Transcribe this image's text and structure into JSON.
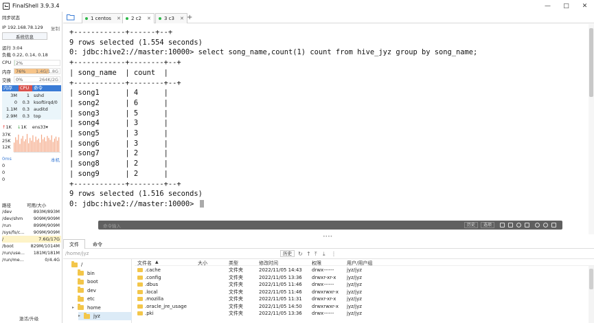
{
  "window": {
    "title": "FinalShell 3.9.3.4",
    "controls": [
      "minimize-icon",
      "maximize-icon",
      "close-icon"
    ]
  },
  "sidebar": {
    "sync_status": "同步状态",
    "ip_label": "IP 192.168.78.129",
    "copy_label": "复制",
    "sysinfo_button": "系统信息",
    "uptime": "运行 3:04",
    "load": "负载 0.22, 0.14, 0.18",
    "cpu": {
      "label": "CPU",
      "value": "2%",
      "percent": 2
    },
    "mem": {
      "label": "内存",
      "value": "76%",
      "detail": "1.4G/1.8G",
      "percent": 76
    },
    "swap": {
      "label": "交换",
      "value": "0%",
      "detail": "264K/2G",
      "percent": 0
    },
    "proc_headers": [
      "内存",
      "CPU",
      "命令"
    ],
    "processes": [
      {
        "mem": "3M",
        "cpu": "1",
        "cmd": "sshd"
      },
      {
        "mem": "0",
        "cpu": "0.3",
        "cmd": "ksoftirqd/0"
      },
      {
        "mem": "1.1M",
        "cpu": "0.3",
        "cmd": "auditd"
      },
      {
        "mem": "2.9M",
        "cpu": "0.3",
        "cmd": "top"
      }
    ],
    "net": {
      "up": "1K",
      "down": "1K",
      "iface": "ens33"
    },
    "net_scale": [
      "37K",
      "25K",
      "12K"
    ],
    "latency": {
      "ms_label": "0ms",
      "host_label": "本机",
      "values": [
        "0",
        "0",
        "0"
      ]
    },
    "disk_headers": [
      "路径",
      "可用/大小"
    ],
    "disks": [
      {
        "path": "/dev",
        "size": "893M/893M"
      },
      {
        "path": "/dev/shm",
        "size": "909M/909M"
      },
      {
        "path": "/run",
        "size": "899M/909M"
      },
      {
        "path": "/sys/fs/c...",
        "size": "909M/909M"
      },
      {
        "path": "/",
        "size": "7.6G/17G"
      },
      {
        "path": "/boot",
        "size": "829M/1014M"
      },
      {
        "path": "/run/use...",
        "size": "181M/181M"
      },
      {
        "path": "/run/me...",
        "size": "0/4.4G"
      }
    ],
    "activate_label": "激活/升级"
  },
  "tabs": [
    {
      "label": "1 centos",
      "active": false
    },
    {
      "label": "2 c2",
      "active": true
    },
    {
      "label": "3 c3",
      "active": false
    }
  ],
  "terminal": {
    "lines": [
      "+------------+------+--+",
      "9 rows selected (1.554 seconds)",
      "0: jdbc:hive2://master:10000> select song_name,count(1) count from hive_jyz group by song_name;",
      "+------------+--------+--+",
      "| song_name  | count  |",
      "+------------+--------+--+",
      "| song1      | 4      |",
      "| song2      | 6      |",
      "| song3      | 5      |",
      "| song4      | 3      |",
      "| song5      | 3      |",
      "| song6      | 3      |",
      "| song7      | 2      |",
      "| song8      | 2      |",
      "| song9      | 2      |",
      "+------------+--------+--+",
      "9 rows selected (1.516 seconds)"
    ],
    "prompt": "0: jdbc:hive2://master:10000> "
  },
  "command_bar": {
    "placeholder": "命令输入",
    "history_button": "历史",
    "options_button": "选项"
  },
  "bottom_tabs": [
    "文件",
    "命令"
  ],
  "file_browser": {
    "path": "/home/jyz",
    "history_button": "历史",
    "tree": [
      {
        "label": "/",
        "depth": 0
      },
      {
        "label": "bin",
        "depth": 1
      },
      {
        "label": "boot",
        "depth": 1
      },
      {
        "label": "dev",
        "depth": 1
      },
      {
        "label": "etc",
        "depth": 1
      },
      {
        "label": "home",
        "depth": 1
      },
      {
        "label": "jyz",
        "depth": 2,
        "selected": true
      }
    ],
    "columns": [
      "文件名",
      "大小",
      "类型",
      "修改时间",
      "权限",
      "用户/用户组"
    ],
    "files": [
      {
        "name": ".cache",
        "size": "",
        "type": "文件夹",
        "mtime": "2022/11/05 14:43",
        "perm": "drwx------",
        "owner": "jyz/jyz"
      },
      {
        "name": ".config",
        "size": "",
        "type": "文件夹",
        "mtime": "2022/11/05 13:36",
        "perm": "drwxr-xr-x",
        "owner": "jyz/jyz"
      },
      {
        "name": ".dbus",
        "size": "",
        "type": "文件夹",
        "mtime": "2022/11/05 11:46",
        "perm": "drwx------",
        "owner": "jyz/jyz"
      },
      {
        "name": ".local",
        "size": "",
        "type": "文件夹",
        "mtime": "2022/11/05 11:46",
        "perm": "drwxrwxr-x",
        "owner": "jyz/jyz"
      },
      {
        "name": ".mozilla",
        "size": "",
        "type": "文件夹",
        "mtime": "2022/11/05 11:31",
        "perm": "drwxr-xr-x",
        "owner": "jyz/jyz"
      },
      {
        "name": ".oracle_jre_usage",
        "size": "",
        "type": "文件夹",
        "mtime": "2022/11/05 14:50",
        "perm": "drwxrwxr-x",
        "owner": "jyz/jyz"
      },
      {
        "name": ".pki",
        "size": "",
        "type": "文件夹",
        "mtime": "2022/11/05 13:36",
        "perm": "drwx------",
        "owner": "jyz/jyz"
      }
    ]
  },
  "colors": {
    "cpu_tab": "#d9534f",
    "mem_tab": "#3a7bd5",
    "cmd_tab": "#3a7bd5",
    "mem_meter": "#f6c48a",
    "swap_meter": "#c8e6c9",
    "cpu_meter": "#c8e6c9",
    "net_up": "#e53935",
    "net_down": "#43a047",
    "net_graph": "#f4a582",
    "folder": "#f3c64a",
    "command_bar": "#606060"
  }
}
